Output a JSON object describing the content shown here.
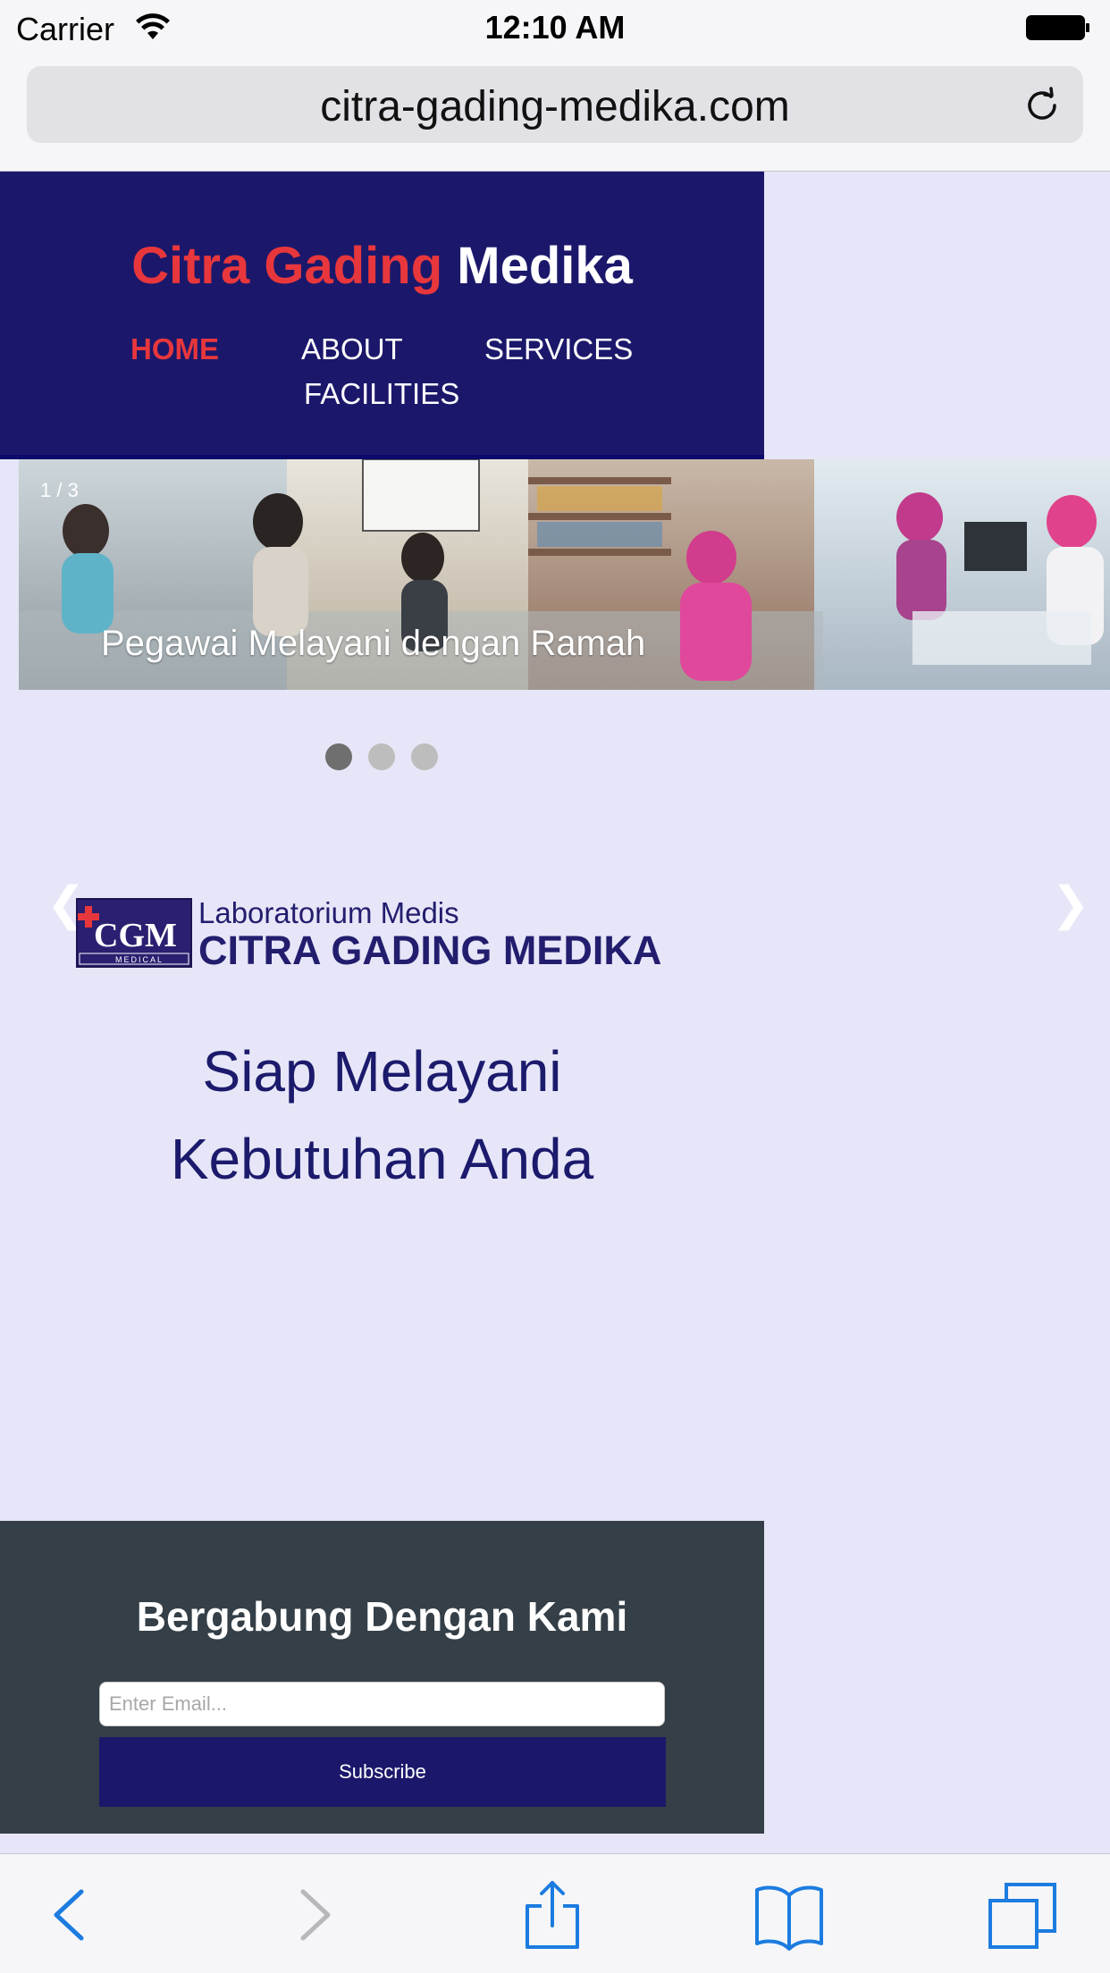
{
  "status_bar": {
    "carrier": "Carrier",
    "time": "12:10 AM"
  },
  "browser": {
    "url": "citra-gading-medika.com"
  },
  "header": {
    "brand_part1": "Citra Gading",
    "brand_part2": "Medika",
    "nav": {
      "home": "HOME",
      "about": "ABOUT",
      "services": "SERVICES",
      "facilities": "FACILITIES"
    }
  },
  "slideshow": {
    "counter": "1 / 3",
    "caption": "Pegawai Melayani dengan Ramah",
    "prev": "❮",
    "next": "❯",
    "total_slides": 3,
    "active_slide": 1
  },
  "lab": {
    "logo_text": "CGM",
    "logo_sub": "MEDICAL",
    "subtitle": "Laboratorium Medis",
    "title": "CITRA GADING MEDIKA"
  },
  "tagline": {
    "line1": "Siap Melayani",
    "line2": "Kebutuhan Anda"
  },
  "newsletter": {
    "title": "Bergabung Dengan Kami",
    "email_placeholder": "Enter Email...",
    "subscribe_label": "Subscribe"
  },
  "colors": {
    "header_bg": "#1b186b",
    "brand_red": "#e8373c",
    "page_bg": "#e6e6f8",
    "newsletter_bg": "#353f47",
    "ios_blue": "#1c7ce0"
  }
}
